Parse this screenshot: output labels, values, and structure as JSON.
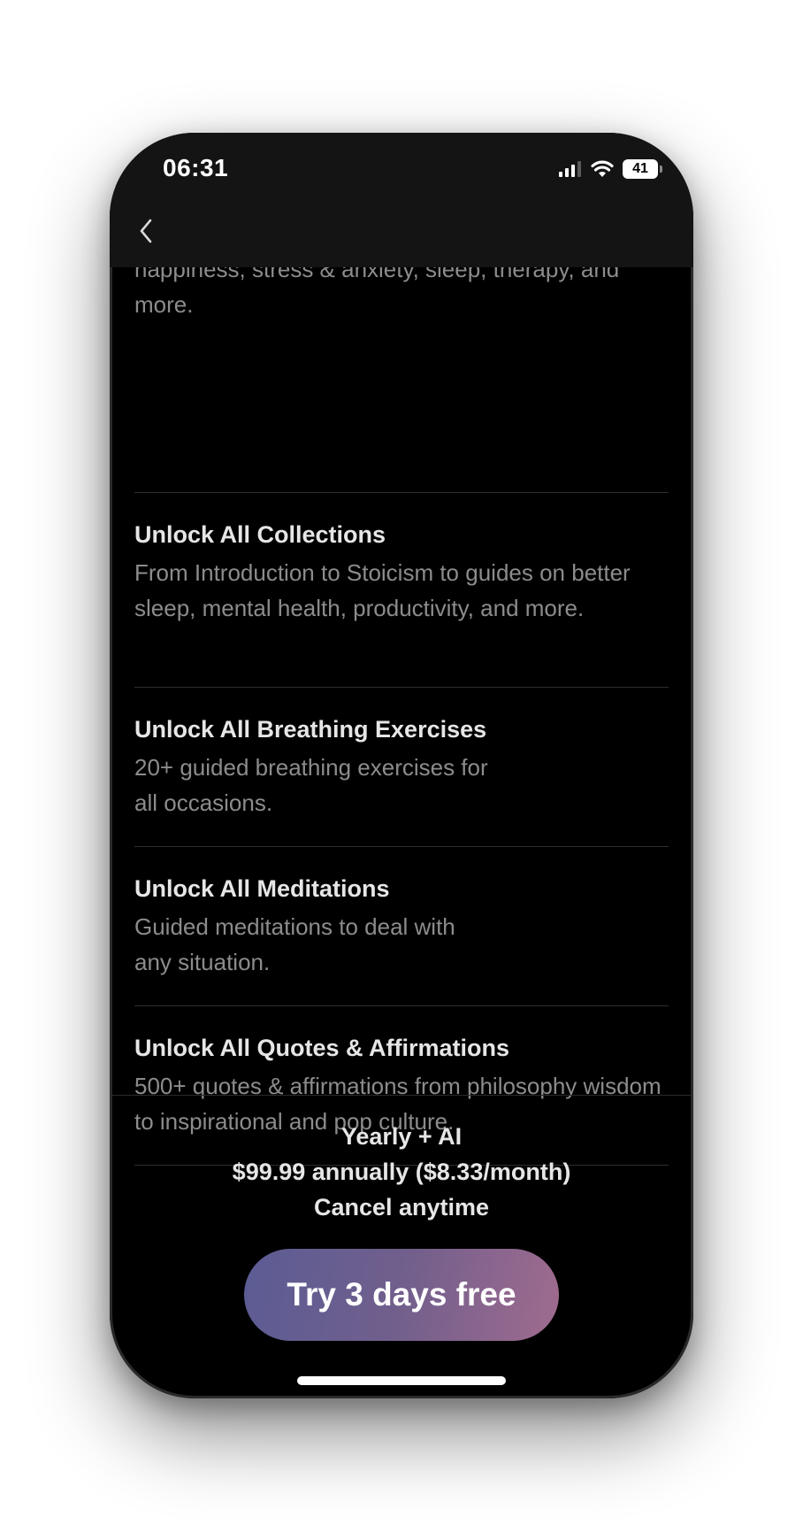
{
  "status_bar": {
    "time": "06:31",
    "battery_level": "41",
    "icons": [
      "signal-icon",
      "wifi-icon",
      "battery-icon"
    ]
  },
  "nav": {
    "back_icon": "chevron-left-icon"
  },
  "intro": {
    "text": "happiness, stress & anxiety, sleep, therapy, and more."
  },
  "features": [
    {
      "title": "Unlock All Collections",
      "description": "From Introduction to Stoicism to guides on better sleep, mental health, productivity, and more."
    },
    {
      "title": "Unlock All Breathing Exercises",
      "description_lines": [
        "20+ guided breathing exercises for",
        "all occasions."
      ]
    },
    {
      "title": "Unlock All Meditations",
      "description_lines": [
        "Guided meditations to deal with",
        "any situation."
      ]
    },
    {
      "title": "Unlock All Quotes & Affirmations",
      "description": "500+ quotes & affirmations from philosophy wisdom to inspirational and pop culture."
    }
  ],
  "plan": {
    "name": "Yearly + AI",
    "price": "$99.99 annually ($8.33/month)",
    "note": "Cancel anytime"
  },
  "cta": {
    "label": "Try 3 days free"
  },
  "colors": {
    "background": "#000000",
    "header": "#141414",
    "title_text": "#e6e6e6",
    "body_text": "#8c8c8c",
    "cta_gradient_start": "#5b5c94",
    "cta_gradient_end": "#a06b8f"
  }
}
